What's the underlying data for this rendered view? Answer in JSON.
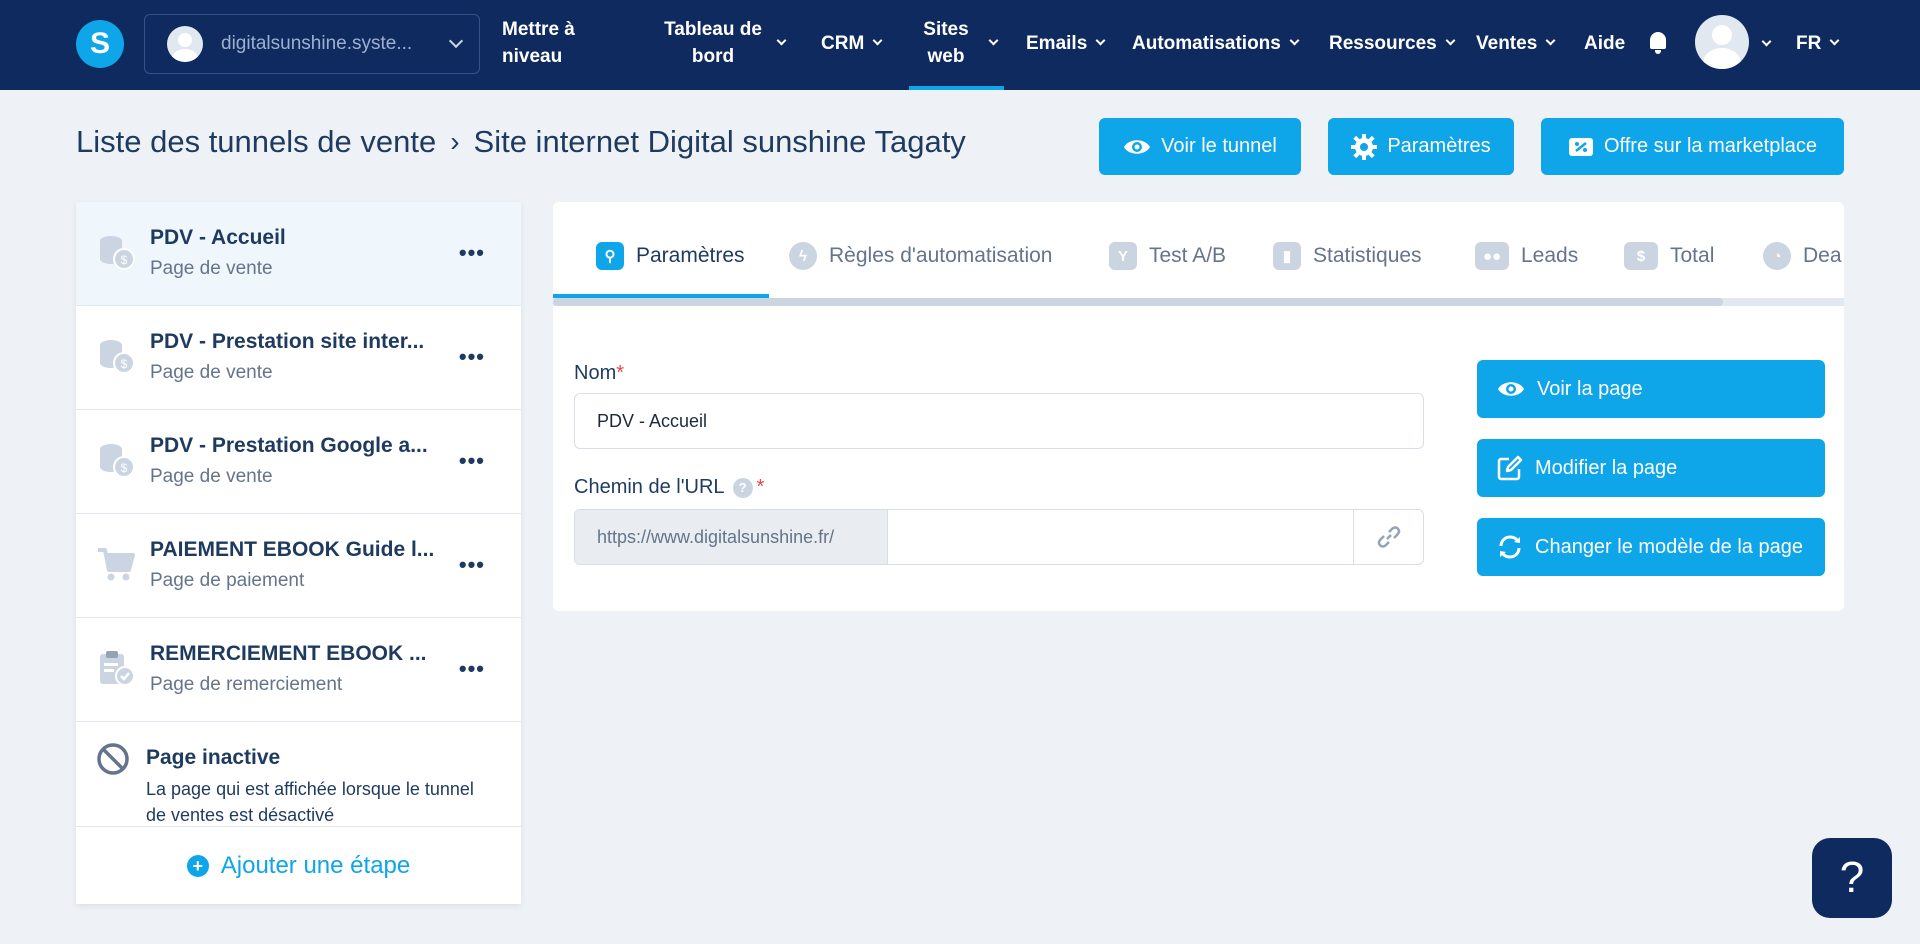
{
  "navbar": {
    "logo_letter": "S",
    "account_name": "digitalsunshine.syste...",
    "items": [
      {
        "label": "Mettre à niveau"
      },
      {
        "label": "Tableau de bord"
      },
      {
        "label": "CRM"
      },
      {
        "label": "Sites web"
      },
      {
        "label": "Emails"
      },
      {
        "label": "Automatisations"
      },
      {
        "label": "Ressources"
      },
      {
        "label": "Ventes"
      },
      {
        "label": "Aide"
      }
    ],
    "language": "FR"
  },
  "header": {
    "breadcrumb_root": "Liste des tunnels de vente",
    "breadcrumb_sep": "›",
    "breadcrumb_current": "Site internet Digital sunshine Tagaty",
    "buttons": {
      "view_funnel": "Voir le tunnel",
      "settings": "Paramètres",
      "marketplace": "Offre sur la marketplace"
    }
  },
  "sidebar": {
    "steps": [
      {
        "title": "PDV - Accueil",
        "subtitle": "Page de vente",
        "icon": "coins-icon",
        "active": true
      },
      {
        "title": "PDV - Prestation site inter...",
        "subtitle": "Page de vente",
        "icon": "coins-icon",
        "active": false
      },
      {
        "title": "PDV - Prestation Google a...",
        "subtitle": "Page de vente",
        "icon": "coins-icon",
        "active": false
      },
      {
        "title": "PAIEMENT EBOOK Guide l...",
        "subtitle": "Page de paiement",
        "icon": "cart-icon",
        "active": false
      },
      {
        "title": "REMERCIEMENT EBOOK ...",
        "subtitle": "Page de remerciement",
        "icon": "clipboard-check-icon",
        "active": false
      }
    ],
    "more_label": "•••",
    "inactive": {
      "title": "Page inactive",
      "description": "La page qui est affichée lorsque le tunnel de ventes est désactivé"
    },
    "add_step_label": "Ajouter une étape"
  },
  "tabs": [
    {
      "label": "Paramètres",
      "icon": "sliders-icon",
      "active": true
    },
    {
      "label": "Règles d'automatisation",
      "icon": "bolt-icon",
      "active": false
    },
    {
      "label": "Test A/B",
      "icon": "split-icon",
      "active": false
    },
    {
      "label": "Statistiques",
      "icon": "chart-icon",
      "active": false
    },
    {
      "label": "Leads",
      "icon": "users-icon",
      "active": false
    },
    {
      "label": "Total",
      "icon": "dollar-icon",
      "active": false
    },
    {
      "label": "Dea",
      "icon": "clock-icon",
      "active": false
    }
  ],
  "form": {
    "name_label": "Nom",
    "name_value": "PDV - Accueil",
    "url_label": "Chemin de l'URL",
    "url_prefix": "https://www.digitalsunshine.fr/",
    "url_value": "",
    "required_mark": "*",
    "help_mark": "?"
  },
  "actions": {
    "view_page": "Voir la page",
    "edit_page": "Modifier la page",
    "change_template": "Changer le modèle de la page"
  },
  "help_fab": "?",
  "colors": {
    "navbar": "#0f2a5e",
    "accent": "#0ea5e9",
    "background": "#eef2f7"
  }
}
